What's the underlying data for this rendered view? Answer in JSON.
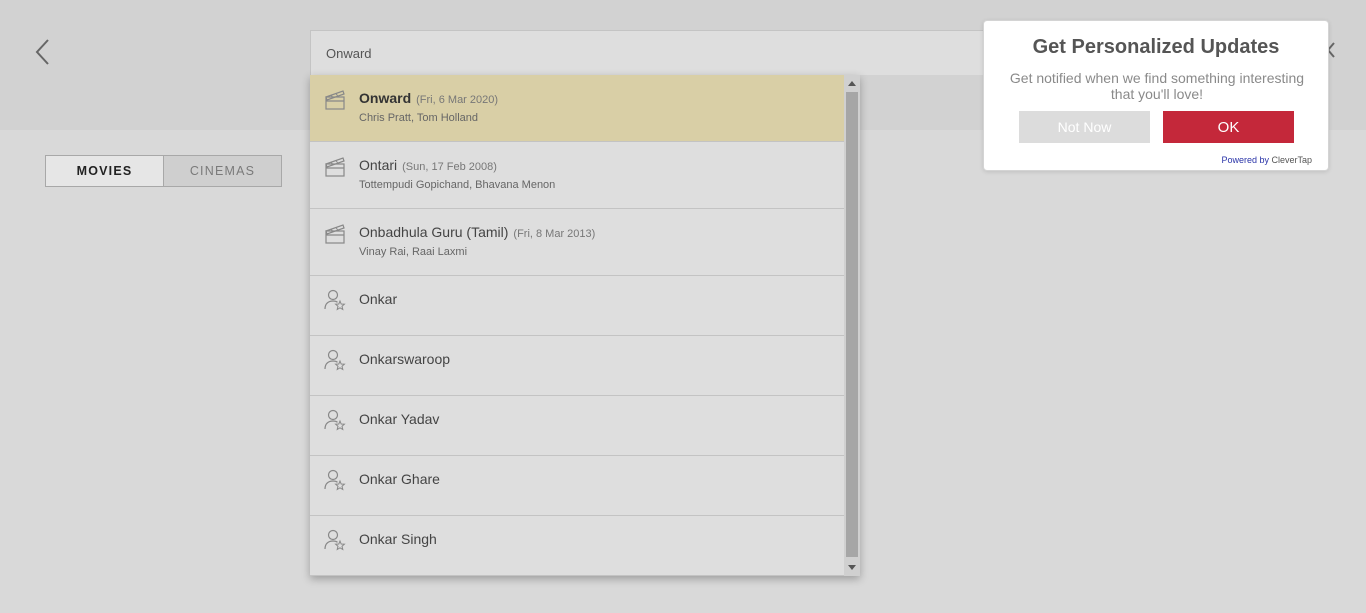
{
  "search": {
    "value": "Onward"
  },
  "tabs": [
    {
      "label": "MOVIES",
      "active": true
    },
    {
      "label": "CINEMAS",
      "active": false
    }
  ],
  "results": [
    {
      "type": "movie",
      "title": "Onward",
      "date": "(Fri, 6 Mar 2020)",
      "cast": "Chris Pratt, Tom Holland",
      "highlighted": true,
      "icon": "clapperboard-icon"
    },
    {
      "type": "movie",
      "title": "Ontari",
      "date": "(Sun, 17 Feb 2008)",
      "cast": "Tottempudi Gopichand, Bhavana Menon",
      "icon": "clapperboard-icon"
    },
    {
      "type": "movie",
      "title": "Onbadhula Guru (Tamil)",
      "date": "(Fri, 8 Mar 2013)",
      "cast": "Vinay Rai, Raai Laxmi",
      "icon": "clapperboard-icon"
    },
    {
      "type": "person",
      "title": "Onkar",
      "icon": "person-star-icon"
    },
    {
      "type": "person",
      "title": "Onkarswaroop",
      "icon": "person-star-icon"
    },
    {
      "type": "person",
      "title": "Onkar Yadav",
      "icon": "person-star-icon"
    },
    {
      "type": "person",
      "title": "Onkar Ghare",
      "icon": "person-star-icon"
    },
    {
      "type": "person",
      "title": "Onkar Singh",
      "icon": "person-star-icon"
    }
  ],
  "notification": {
    "title": "Get Personalized Updates",
    "message": "Get notified when we find something interesting that you'll love!",
    "decline_label": "Not Now",
    "accept_label": "OK",
    "powered_prefix": "Powered by ",
    "powered_brand_a": "Clever",
    "powered_brand_b": "Tap"
  },
  "colors": {
    "highlight": "#d9cfa6",
    "accent": "#c4283a",
    "overlay_bg": "#d9d9d9"
  }
}
